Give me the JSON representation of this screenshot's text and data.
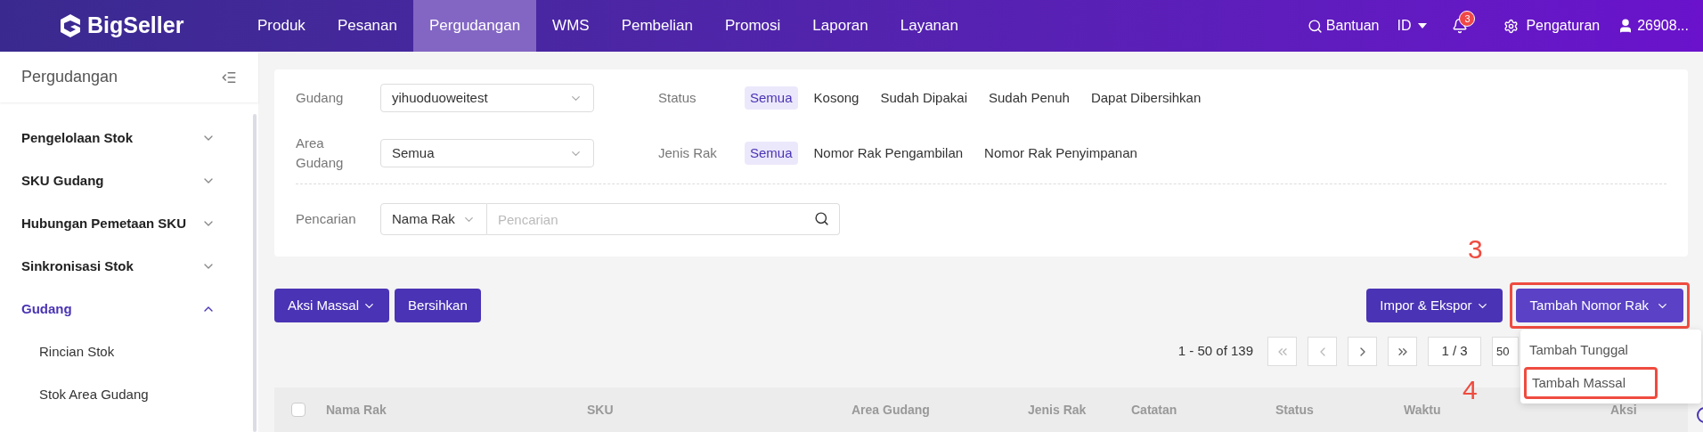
{
  "header": {
    "logo": "BigSeller",
    "nav": [
      {
        "label": "Produk",
        "selected": false
      },
      {
        "label": "Pesanan",
        "selected": false
      },
      {
        "label": "Pergudangan",
        "selected": true
      },
      {
        "label": "WMS",
        "selected": false
      },
      {
        "label": "Pembelian",
        "selected": false
      },
      {
        "label": "Promosi",
        "selected": false
      },
      {
        "label": "Laporan",
        "selected": false
      },
      {
        "label": "Layanan",
        "selected": false
      }
    ],
    "help": "Bantuan",
    "language": "ID",
    "notifications": "3",
    "settings": "Pengaturan",
    "user": "26908..."
  },
  "sidebar": {
    "title": "Pergudangan",
    "items": [
      {
        "label": "Pengelolaan Stok",
        "expanded": false,
        "selected": false
      },
      {
        "label": "SKU Gudang",
        "expanded": false,
        "selected": false
      },
      {
        "label": "Hubungan Pemetaan SKU",
        "expanded": false,
        "selected": false
      },
      {
        "label": "Sinkronisasi Stok",
        "expanded": false,
        "selected": false
      },
      {
        "label": "Gudang",
        "expanded": true,
        "selected": true,
        "children": [
          {
            "label": "Rincian Stok"
          },
          {
            "label": "Stok Area Gudang"
          }
        ]
      }
    ]
  },
  "filters": {
    "warehouse": {
      "label": "Gudang",
      "value": "yihuoduoweitest"
    },
    "area": {
      "label": "Area Gudang",
      "value": "Semua"
    },
    "status": {
      "label": "Status",
      "options": [
        {
          "label": "Semua",
          "selected": true
        },
        {
          "label": "Kosong",
          "selected": false
        },
        {
          "label": "Sudah Dipakai",
          "selected": false
        },
        {
          "label": "Sudah Penuh",
          "selected": false
        },
        {
          "label": "Dapat Dibersihkan",
          "selected": false
        }
      ]
    },
    "rack_type": {
      "label": "Jenis Rak",
      "options": [
        {
          "label": "Semua",
          "selected": true
        },
        {
          "label": "Nomor Rak Pengambilan",
          "selected": false
        },
        {
          "label": "Nomor Rak Penyimpanan",
          "selected": false
        }
      ]
    },
    "search": {
      "label": "Pencarian",
      "field": "Nama Rak",
      "placeholder": "Pencarian"
    }
  },
  "toolbar": {
    "left": [
      "Aksi Massal",
      "Bersihkan"
    ],
    "import_export": "Impor & Ekspor",
    "add": "Tambah Nomor Rak",
    "add_menu": [
      {
        "label": "Tambah Tunggal",
        "highlighted": false
      },
      {
        "label": "Tambah Massal",
        "highlighted": true
      }
    ]
  },
  "pagination": {
    "range": "1 - 50 of 139",
    "page": "1 / 3",
    "page_size": "50"
  },
  "annotations": [
    "3",
    "4"
  ],
  "table": {
    "select_all_checked": false,
    "columns": [
      "Nama Rak",
      "SKU",
      "Area Gudang",
      "Jenis Rak",
      "Catatan",
      "Status",
      "Waktu",
      "Aksi"
    ]
  }
}
